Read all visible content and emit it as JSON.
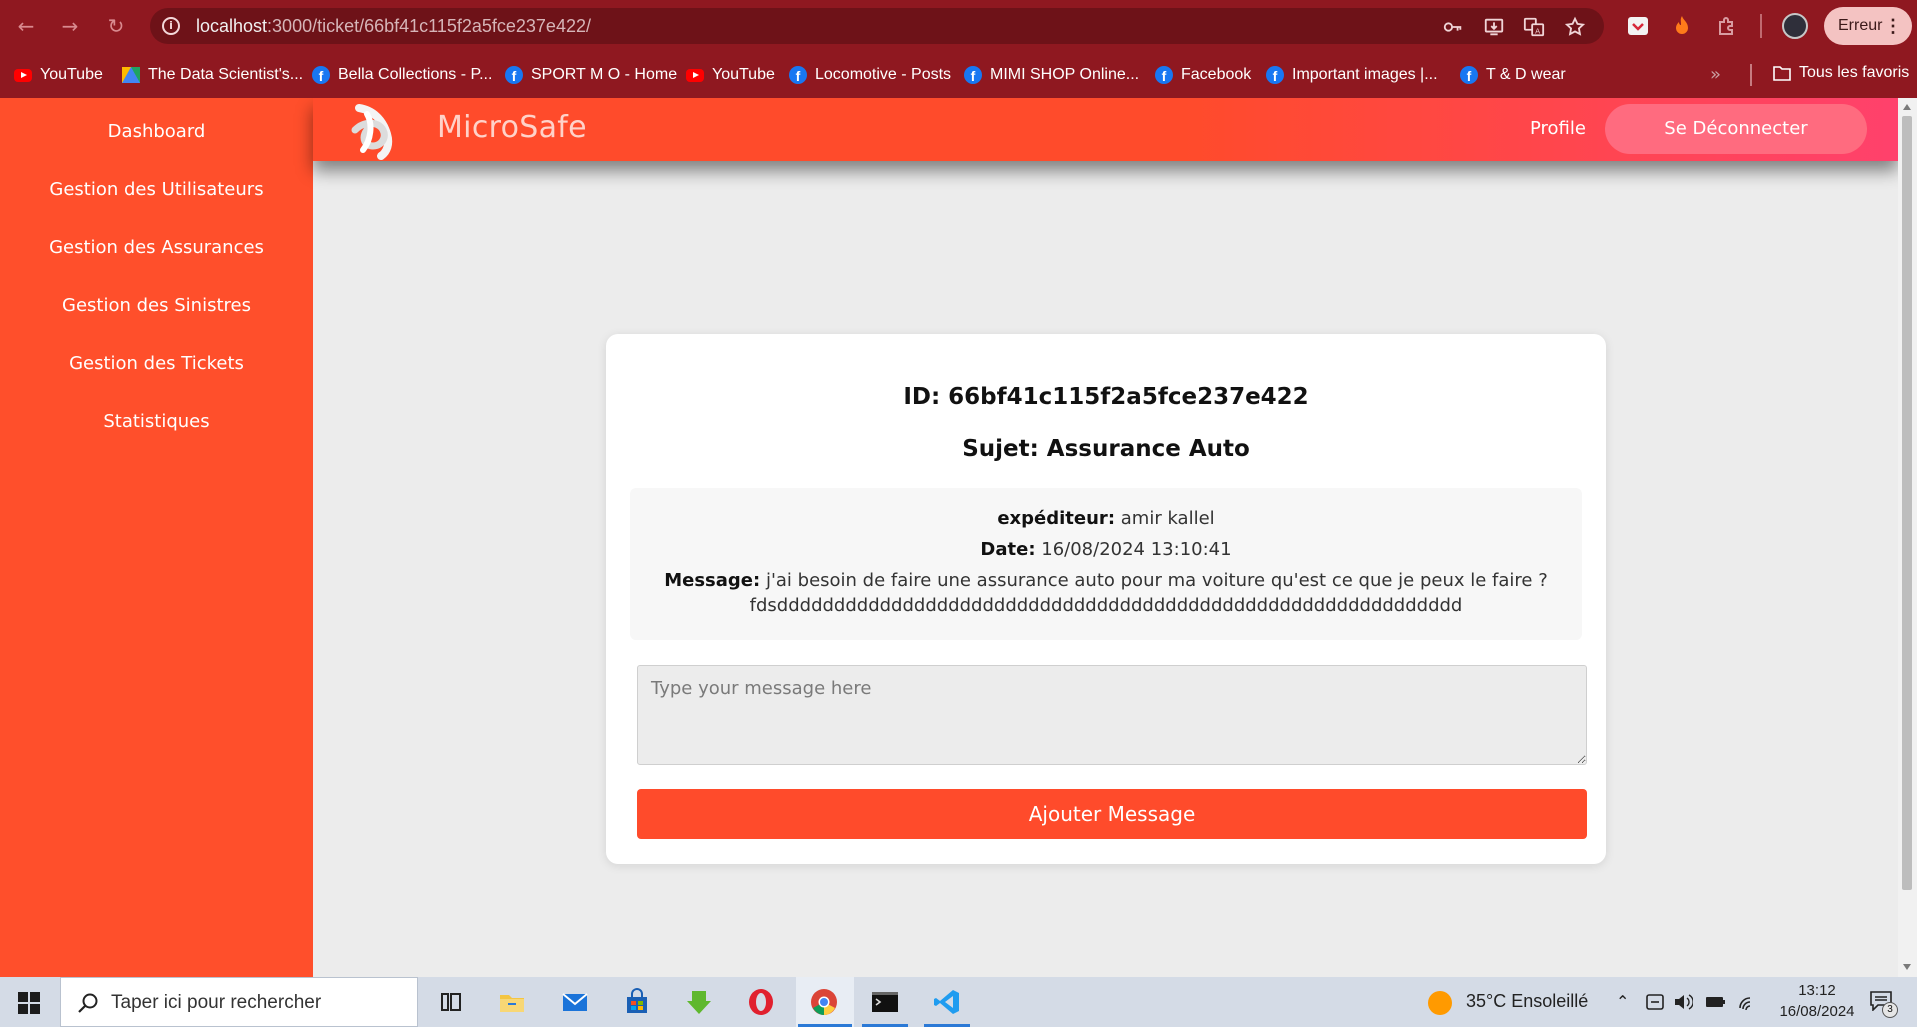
{
  "browser": {
    "url_host": "localhost",
    "url_path": ":3000/ticket/66bf41c115f2a5fce237e422/",
    "profile_status": "Erreur",
    "bookmarks": [
      {
        "label": "YouTube",
        "icon": "youtube-icon"
      },
      {
        "label": "The Data Scientist's...",
        "icon": "drive-icon"
      },
      {
        "label": "Bella Collections - P...",
        "icon": "facebook-icon"
      },
      {
        "label": "SPORT M O - Home",
        "icon": "facebook-icon"
      },
      {
        "label": "YouTube",
        "icon": "youtube-icon"
      },
      {
        "label": "Locomotive - Posts",
        "icon": "facebook-icon"
      },
      {
        "label": "MIMI SHOP Online...",
        "icon": "facebook-icon"
      },
      {
        "label": "Facebook",
        "icon": "facebook-icon"
      },
      {
        "label": "Important images |...",
        "icon": "facebook-icon"
      },
      {
        "label": "T & D wear",
        "icon": "facebook-icon"
      }
    ],
    "all_bookmarks_label": "Tous les favoris"
  },
  "sidebar": {
    "items": [
      {
        "label": "Dashboard"
      },
      {
        "label": "Gestion des Utilisateurs"
      },
      {
        "label": "Gestion des Assurances"
      },
      {
        "label": "Gestion des Sinistres"
      },
      {
        "label": "Gestion des Tickets"
      },
      {
        "label": "Statistiques"
      }
    ]
  },
  "header": {
    "brand": "MicroSafe",
    "profile_label": "Profile",
    "logout_label": "Se Déconnecter"
  },
  "ticket": {
    "id_line": "ID: 66bf41c115f2a5fce237e422",
    "subject_line": "Sujet: Assurance Auto",
    "sender_label": "expéditeur:",
    "sender_value": "amir kallel",
    "date_label": "Date:",
    "date_value": "16/08/2024 13:10:41",
    "message_label": "Message:",
    "message_value": "j'ai besoin de faire une assurance auto pour ma voiture qu'est ce que je peux le faire ?",
    "message_value_2": "fdsdddddddddddddddddddddddddddddddddddddddddddddddddddddddddddd",
    "reply_placeholder": "Type your message here",
    "add_label": "Ajouter Message"
  },
  "taskbar": {
    "search_placeholder": "Taper ici pour rechercher",
    "weather": "35°C  Ensoleillé",
    "time": "13:12",
    "date": "16/08/2024",
    "notification_count": "3"
  },
  "colors": {
    "brand_orange": "#ff4b2b",
    "brand_pink": "#ff416c",
    "browser_red": "#8f1820"
  }
}
